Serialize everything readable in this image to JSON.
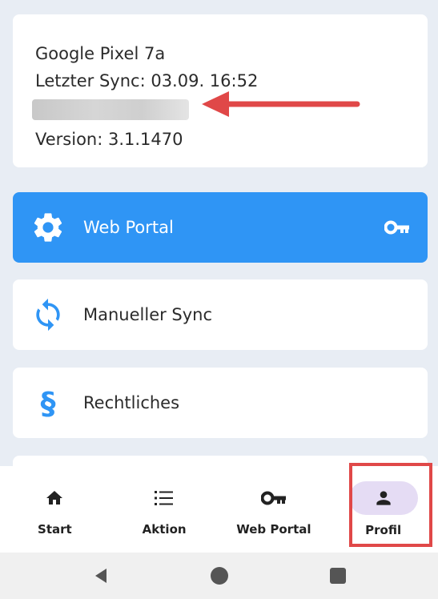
{
  "device": {
    "name": "Google Pixel 7a",
    "last_sync": "Letzter Sync: 03.09. 16:52",
    "version": "Version: 3.1.1470"
  },
  "menu": {
    "items": [
      {
        "label": "Web Portal",
        "icon": "gear-icon",
        "trailing_icon": "key-icon",
        "active": true
      },
      {
        "label": "Manueller Sync",
        "icon": "sync-icon"
      },
      {
        "label": "Rechtliches",
        "icon": "paragraph-icon"
      }
    ]
  },
  "bottom_nav": {
    "items": [
      {
        "label": "Start",
        "icon": "home-icon"
      },
      {
        "label": "Aktion",
        "icon": "list-icon"
      },
      {
        "label": "Web Portal",
        "icon": "key-icon"
      },
      {
        "label": "Profil",
        "icon": "person-icon",
        "selected": true
      }
    ]
  },
  "colors": {
    "accent": "#2f95f5",
    "annotation": "#e04848",
    "selected_pill": "#e5dcf4"
  }
}
